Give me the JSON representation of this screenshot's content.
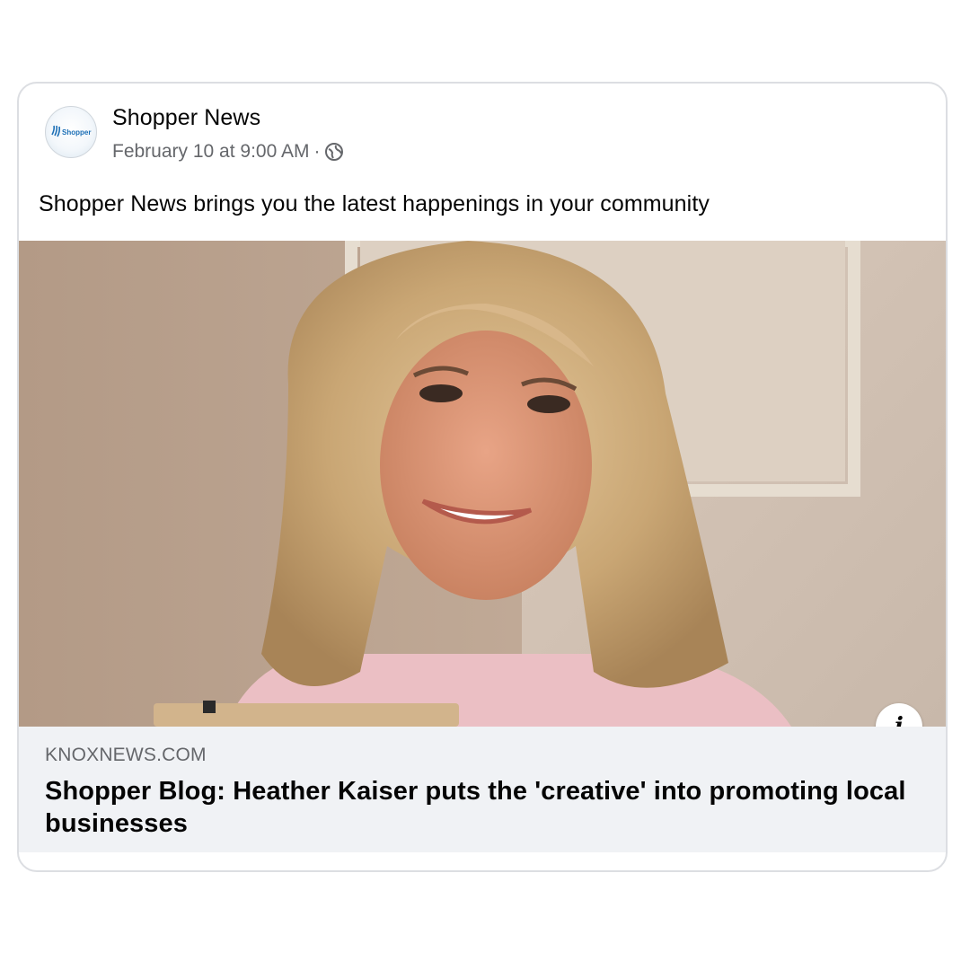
{
  "post": {
    "page_name": "Shopper News",
    "avatar_text": "Shopper",
    "timestamp": "February 10 at 9:00 AM",
    "separator": "·",
    "audience_icon": "globe-icon",
    "text": "Shopper News brings you the latest happenings in your community"
  },
  "link_preview": {
    "image_icon": "photo",
    "info_label": "i",
    "domain": "KNOXNEWS.COM",
    "title": "Shopper Blog: Heather Kaiser puts the 'creative' into promoting local businesses"
  },
  "colors": {
    "primary_text": "#050505",
    "secondary_text": "#65676b",
    "footer_bg": "#f0f2f5",
    "card_border": "#dcdee2"
  }
}
